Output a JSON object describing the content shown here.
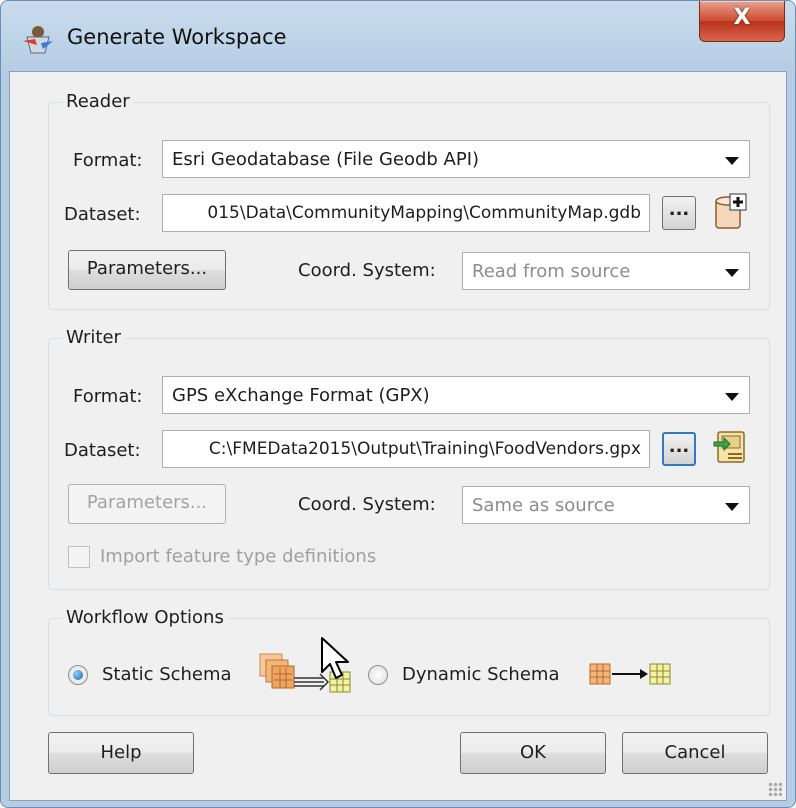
{
  "window": {
    "title": "Generate Workspace",
    "close_glyph": "X"
  },
  "reader": {
    "group_title": "Reader",
    "format_label": "Format:",
    "format_value": "Esri Geodatabase (File Geodb API)",
    "dataset_label": "Dataset:",
    "dataset_value": "015\\Data\\CommunityMapping\\CommunityMap.gdb",
    "browse_label": "...",
    "parameters_label": "Parameters...",
    "coord_label": "Coord. System:",
    "coord_value": "Read from source"
  },
  "writer": {
    "group_title": "Writer",
    "format_label": "Format:",
    "format_value": "GPS eXchange Format (GPX)",
    "dataset_label": "Dataset:",
    "dataset_value": "C:\\FMEData2015\\Output\\Training\\FoodVendors.gpx",
    "browse_label": "...",
    "parameters_label": "Parameters...",
    "coord_label": "Coord. System:",
    "coord_value": "Same as source",
    "import_label": "Import feature type definitions"
  },
  "workflow": {
    "group_title": "Workflow Options",
    "static_label": "Static Schema",
    "dynamic_label": "Dynamic Schema",
    "selected": "static"
  },
  "buttons": {
    "help": "Help",
    "ok": "OK",
    "cancel": "Cancel"
  },
  "colors": {
    "titlebar": "#b5cde4",
    "close": "#cc4a30",
    "client": "#f0f0f0",
    "focus": "#2e7bc4"
  }
}
